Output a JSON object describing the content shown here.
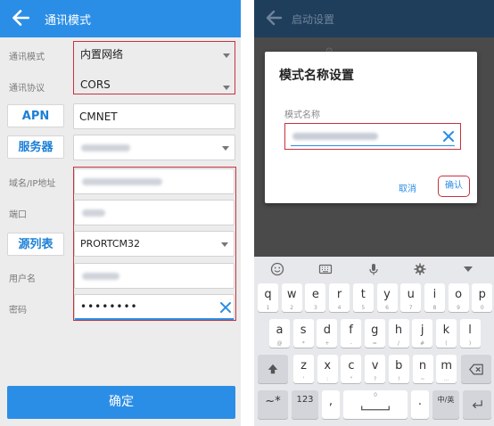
{
  "left": {
    "header": {
      "title": "通讯模式",
      "back_icon": "arrow-left-icon"
    },
    "rows": [
      {
        "label": "通讯模式",
        "value": "内置网络"
      },
      {
        "label": "通讯协议",
        "value": "CORS"
      }
    ],
    "apn": {
      "button": "APN",
      "value": "CMNET"
    },
    "server": {
      "button": "服务器"
    },
    "labels": {
      "domain_ip": "域名/IP地址",
      "port": "端口",
      "username": "用户名",
      "password": "密码"
    },
    "source_table": {
      "button": "源列表",
      "value": "PRORTCM32"
    },
    "password_value": "••••••••",
    "confirm_button": "确定",
    "colors": {
      "accent": "#2b8ee6",
      "highlight": "#c8323f"
    }
  },
  "right": {
    "header": {
      "title": "启动设置",
      "back_icon": "arrow-left-icon"
    },
    "dialog": {
      "title": "模式名称设置",
      "label": "模式名称",
      "cancel": "取消",
      "confirm": "确认"
    },
    "keyboard": {
      "toolbar_icons": [
        "emoji-icon",
        "keyboard-icon",
        "microphone-icon",
        "settings-icon",
        "collapse-icon"
      ],
      "row1": [
        [
          "q",
          "1"
        ],
        [
          "w",
          "2"
        ],
        [
          "e",
          "3"
        ],
        [
          "r",
          "4"
        ],
        [
          "t",
          "5"
        ],
        [
          "y",
          "6"
        ],
        [
          "u",
          "7"
        ],
        [
          "i",
          "8"
        ],
        [
          "o",
          "9"
        ],
        [
          "p",
          "0"
        ]
      ],
      "row2": [
        [
          "a",
          "@"
        ],
        [
          "s",
          "*"
        ],
        [
          "d",
          "+"
        ],
        [
          "f",
          "-"
        ],
        [
          "g",
          "="
        ],
        [
          "h",
          "/"
        ],
        [
          "j",
          "#"
        ],
        [
          "k",
          "("
        ],
        [
          "l",
          ")"
        ]
      ],
      "row3": [
        [
          "z",
          "'"
        ],
        [
          "x",
          ":"
        ],
        [
          "c",
          "\""
        ],
        [
          "v",
          "?"
        ],
        [
          "b",
          "!"
        ],
        [
          "n",
          "~"
        ],
        [
          "m",
          "…"
        ]
      ],
      "row4": {
        "sym": "~*",
        "num": "123",
        "comma": ",",
        "space_sub": "0",
        "period": ".",
        "lang": "中/英"
      }
    }
  }
}
